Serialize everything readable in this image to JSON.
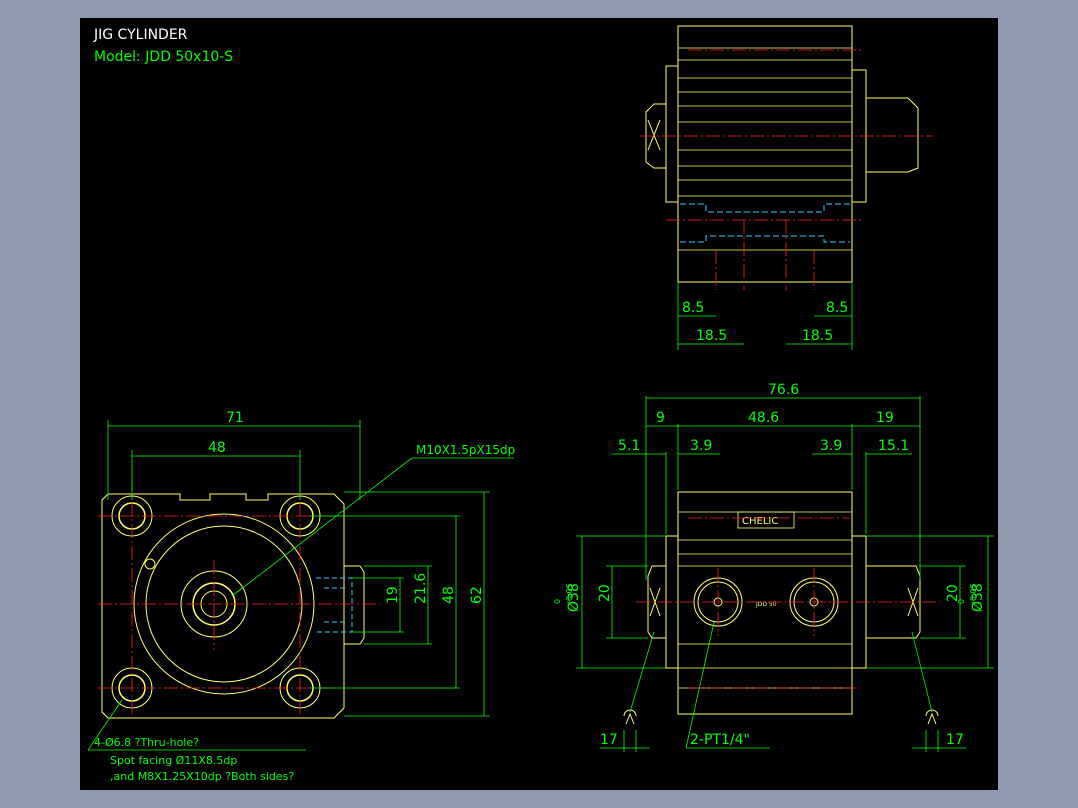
{
  "title": {
    "heading": "JIG CYLINDER",
    "model": "Model:  JDD 50x10-S"
  },
  "colors": {
    "background": "#000000",
    "outline": "#ffff66",
    "dimension": "#00ff00",
    "centerline": "#ff2020",
    "hidden": "#33ccff",
    "text_white": "#ffffff",
    "frame": "#8e9aae"
  },
  "top_view": {
    "dims": [
      "8.5",
      "8.5",
      "18.5",
      "18.5"
    ]
  },
  "left_view": {
    "dims": [
      "71",
      "48",
      "19",
      "21.6",
      "48",
      "62"
    ],
    "leader_thread": "M10X1.5pX15dp",
    "notes": [
      "4-Ø6.8 ?Thru-hole?",
      "Spot facing  Ø11X8.5dp",
      ",and M8X1.25X10dp ?Both sides?"
    ]
  },
  "front_view": {
    "dims": [
      "76.6",
      "9",
      "48.6",
      "19",
      "5.1",
      "3.9",
      "3.9",
      "15.1",
      "20",
      "20",
      "17",
      "17"
    ],
    "tol_left": "Ø38",
    "tol_right": "Ø38",
    "tol_upper": "0",
    "tol_lower": "-0.05",
    "port_note": "2-PT1/4\"",
    "brand": "CHELIC",
    "body_label": "JDD 50"
  }
}
